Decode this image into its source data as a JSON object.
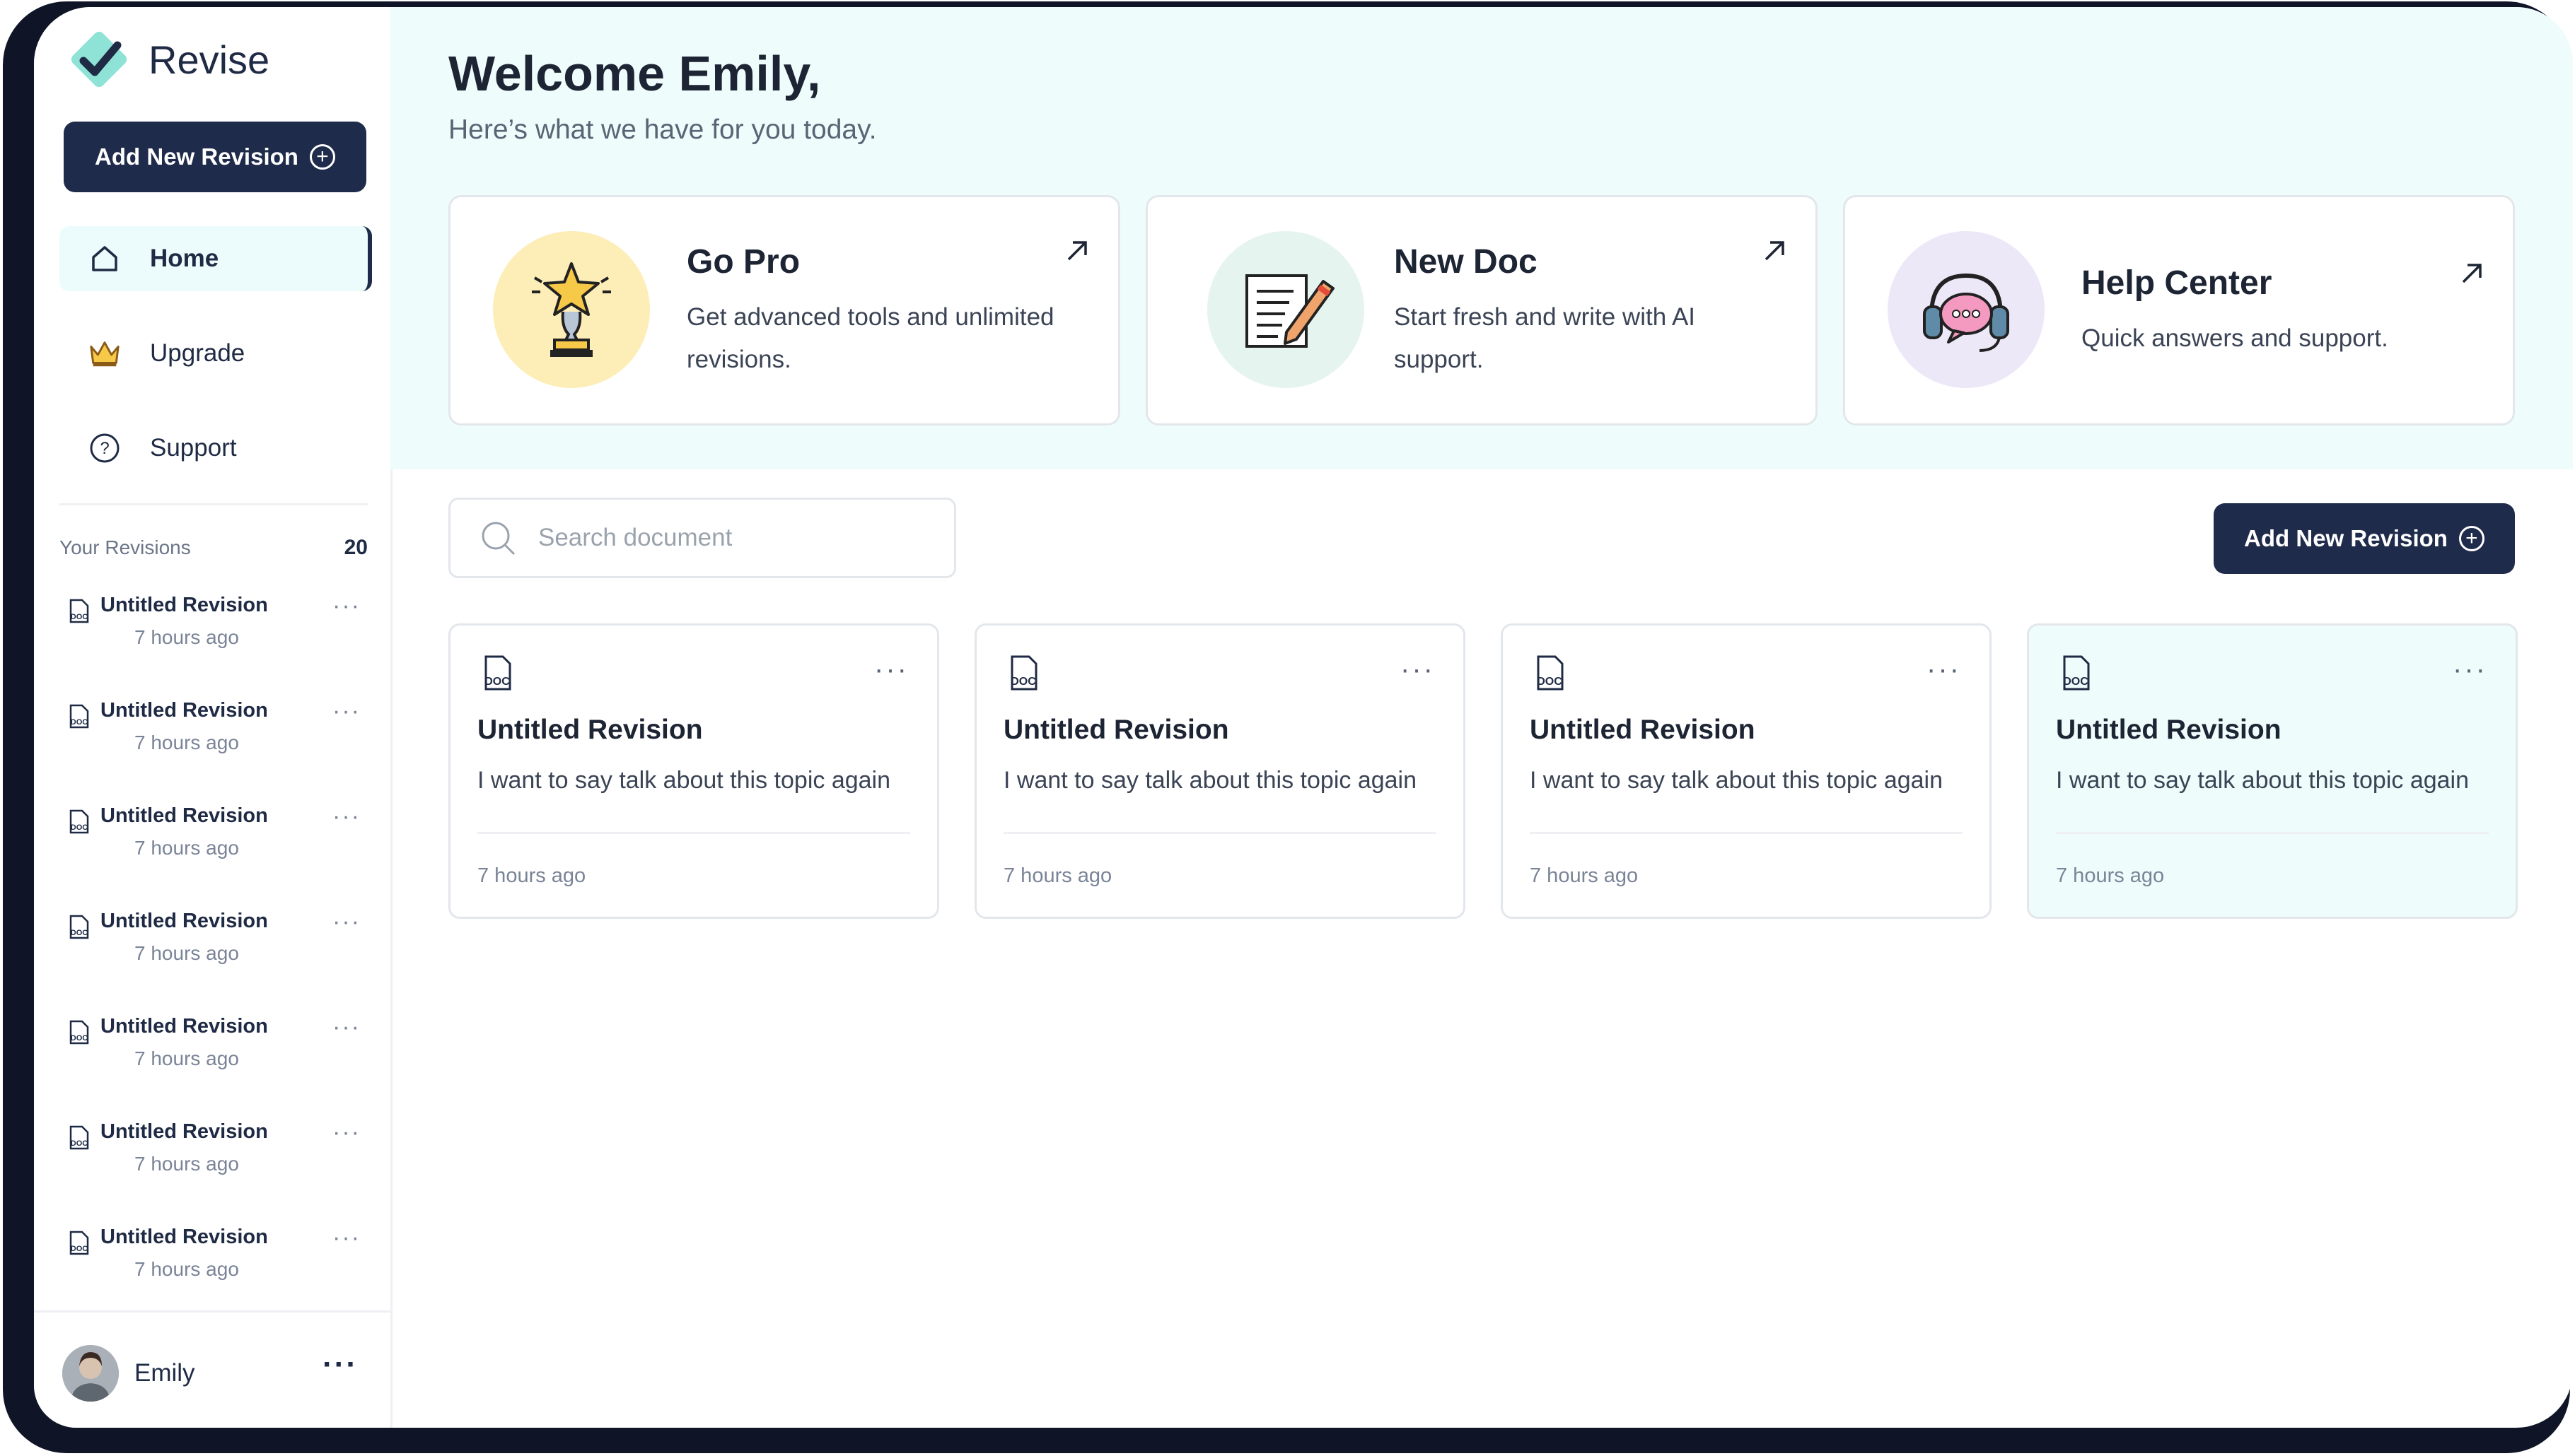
{
  "app": {
    "name": "Revise"
  },
  "sidebar": {
    "add_button": "Add New Revision",
    "nav": [
      {
        "label": "Home",
        "icon": "home-icon",
        "active": true
      },
      {
        "label": "Upgrade",
        "icon": "crown-icon",
        "active": false
      },
      {
        "label": "Support",
        "icon": "help-icon",
        "active": false
      }
    ],
    "revisions_header": "Your Revisions",
    "revisions_count": "20",
    "revisions": [
      {
        "title": "Untitled Revision",
        "time": "7 hours ago"
      },
      {
        "title": "Untitled Revision",
        "time": "7 hours ago"
      },
      {
        "title": "Untitled Revision",
        "time": "7 hours ago"
      },
      {
        "title": "Untitled Revision",
        "time": "7 hours ago"
      },
      {
        "title": "Untitled Revision",
        "time": "7 hours ago"
      },
      {
        "title": "Untitled Revision",
        "time": "7 hours ago"
      },
      {
        "title": "Untitled Revision",
        "time": "7 hours ago"
      }
    ],
    "user": {
      "name": "Emily"
    }
  },
  "main": {
    "welcome": "Welcome Emily,",
    "subtitle": "Here’s what we have for you today.",
    "cards": [
      {
        "title": "Go Pro",
        "desc": "Get advanced tools and unlimited revisions.",
        "icon": "trophy-icon",
        "color": "#fdeeb8"
      },
      {
        "title": "New Doc",
        "desc": "Start fresh and write with AI support.",
        "icon": "document-pencil-icon",
        "color": "#e6f4ef"
      },
      {
        "title": "Help Center",
        "desc": "Quick answers and support.",
        "icon": "headset-icon",
        "color": "#ece8f8"
      }
    ],
    "search_placeholder": "Search document",
    "add_button": "Add New Revision",
    "docs": [
      {
        "title": "Untitled Revision",
        "desc": "I want to say talk about this topic again",
        "time": "7 hours ago"
      },
      {
        "title": "Untitled Revision",
        "desc": "I want to say talk about this topic again",
        "time": "7 hours ago"
      },
      {
        "title": "Untitled Revision",
        "desc": "I want to say talk about this topic again",
        "time": "7 hours ago"
      },
      {
        "title": "Untitled Revision",
        "desc": "I want to say talk about this topic again",
        "time": "7 hours ago"
      }
    ]
  },
  "colors": {
    "primary": "#1f2b4a",
    "accent_bg": "#effcfc",
    "logo_teal": "#8fe3d6"
  }
}
